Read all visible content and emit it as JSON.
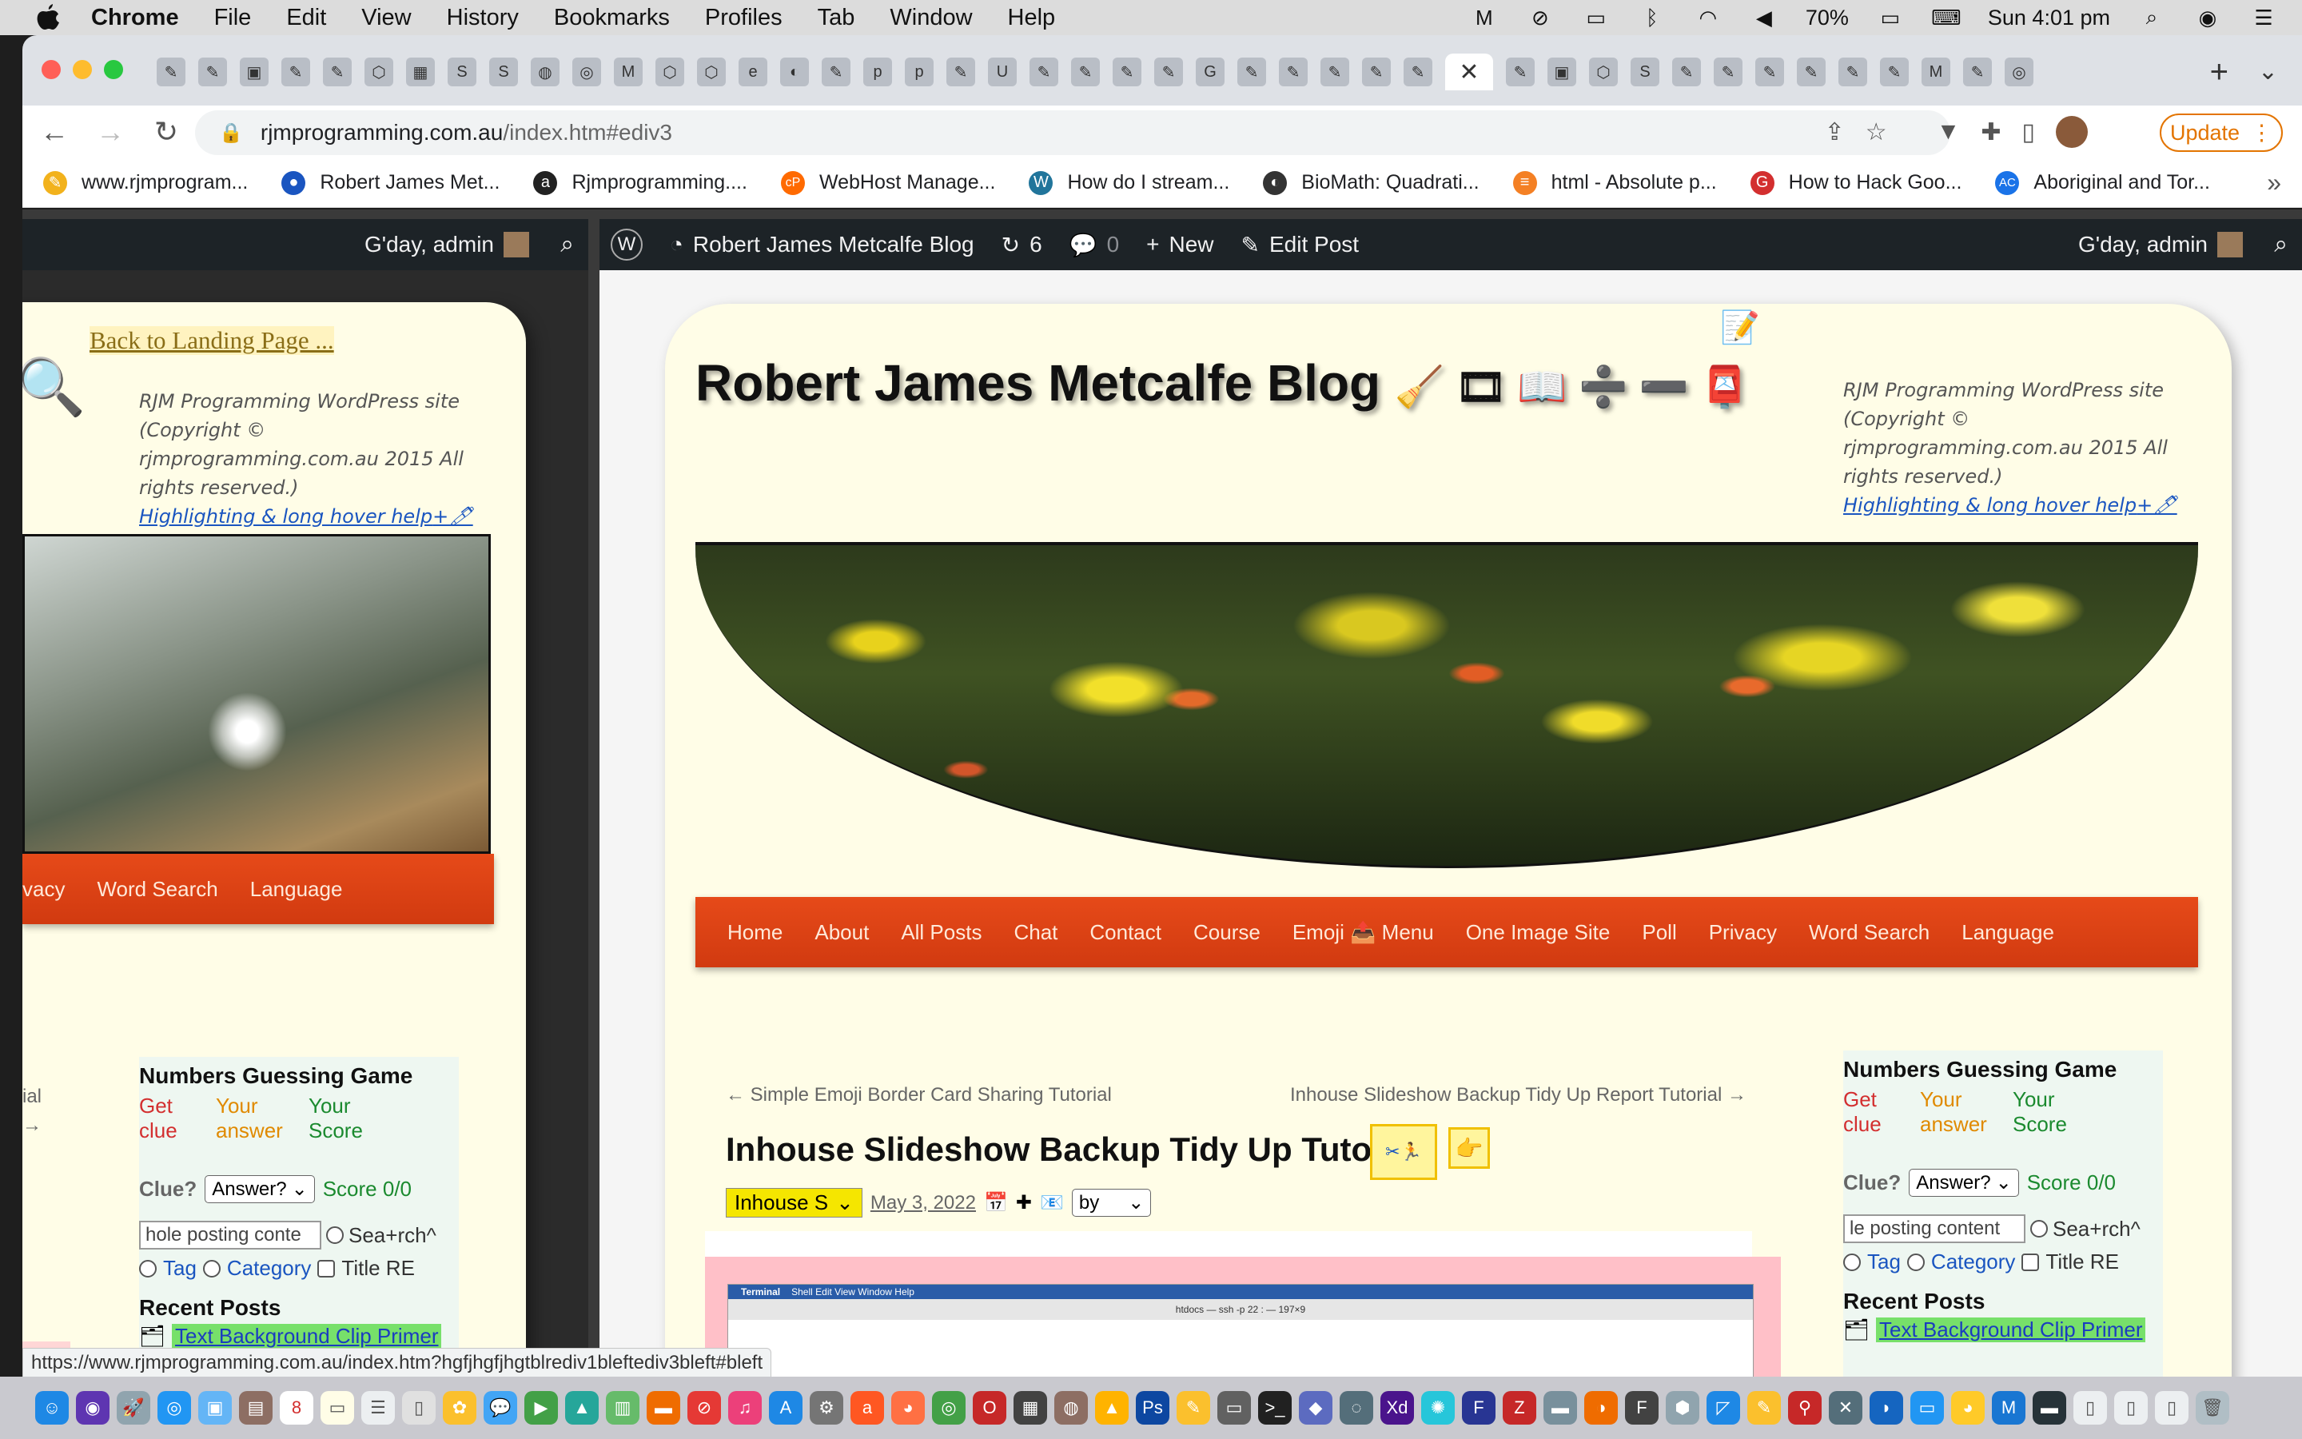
{
  "menubar": {
    "app": "Chrome",
    "items": [
      "File",
      "Edit",
      "View",
      "History",
      "Bookmarks",
      "Profiles",
      "Tab",
      "Window",
      "Help"
    ],
    "battery": "70%",
    "clock": "Sun 4:01 pm"
  },
  "tabs": {
    "close_glyph": "✕",
    "new_tab_glyph": "+",
    "menu_glyph": "⌄"
  },
  "toolbar": {
    "url_host": "rjmprogramming.com.au",
    "url_path": "/index.htm#ediv3",
    "update_label": "Update"
  },
  "bookmarks": [
    {
      "label": "www.rjmprogram...",
      "color": "#f2b21c",
      "glyph": "✎"
    },
    {
      "label": "Robert James Met...",
      "color": "#1a55c0",
      "glyph": "●"
    },
    {
      "label": "Rjmprogramming....",
      "color": "#222222",
      "glyph": "a"
    },
    {
      "label": "WebHost Manage...",
      "color": "#ff6a00",
      "glyph": "cP"
    },
    {
      "label": "How do I stream...",
      "color": "#21759b",
      "glyph": "W"
    },
    {
      "label": "BioMath: Quadrati...",
      "color": "#333333",
      "glyph": "◐"
    },
    {
      "label": "html - Absolute p...",
      "color": "#f48024",
      "glyph": "≡"
    },
    {
      "label": "How to Hack Goo...",
      "color": "#d32f2f",
      "glyph": "G"
    },
    {
      "label": "Aboriginal and Tor...",
      "color": "#1a73e8",
      "glyph": "AC"
    }
  ],
  "adminbar_left": {
    "greeting": "G'day, admin"
  },
  "adminbar_main": {
    "site": "Robert James Metcalfe Blog",
    "updates": "6",
    "comments": "0",
    "new": "New",
    "edit": "Edit Post",
    "greeting": "G'day, admin"
  },
  "left_pane": {
    "back_link": "Back to Landing Page ...",
    "notice": "RJM Programming WordPress site (Copyright © rjmprogramming.com.au 2015 All rights reserved.)",
    "help_link": "Highlighting & long hover help",
    "nav": [
      "vacy",
      "Word Search",
      "Language"
    ],
    "side_fragments": [
      "ial",
      "→"
    ],
    "widget": {
      "title": "Numbers Guessing Game",
      "col1": "Get clue",
      "col2": "Your answer",
      "col3": "Your Score",
      "clue_label": "Clue?",
      "select": "Answer?",
      "score": "Score 0/0",
      "search_value": "hole posting conte",
      "search_radio": "Sea+rch^",
      "tag": "Tag",
      "category": "Category",
      "title_re": "Title RE",
      "recent_heading": "Recent Posts",
      "recent_1": "Text Background Clip Primer"
    }
  },
  "main": {
    "site_title": "Robert James Metcalfe Blog",
    "title_emojis": "🧹 🎞 📖 ➗ ➖ 📮",
    "notice": "RJM Programming WordPress site (Copyright © rjmprogramming.com.au 2015 All rights reserved.)",
    "help_link": "Highlighting & long hover help",
    "nav": [
      "Home",
      "About",
      "All Posts",
      "Chat",
      "Contact",
      "Course",
      "Emoji 📤 Menu",
      "One Image Site",
      "Poll",
      "Privacy",
      "Word Search",
      "Language"
    ],
    "prev_post": "← Simple Emoji Border Card Sharing Tutorial",
    "next_post": "Inhouse Slideshow Backup Tidy Up Report Tutorial →",
    "post_title": "Inhouse Slideshow Backup Tidy Up Tutorial",
    "category_select": "Inhouse S",
    "post_date": "May 3, 2022",
    "by_select": "by",
    "widget": {
      "title": "Numbers Guessing Game",
      "col1": "Get clue",
      "col2": "Your answer",
      "col3": "Your Score",
      "clue_label": "Clue?",
      "select": "Answer?",
      "score": "Score 0/0",
      "search_value": "le posting content",
      "search_radio": "Sea+rch^",
      "tag": "Tag",
      "category": "Category",
      "title_re": "Title RE",
      "recent_heading": "Recent Posts",
      "recent_1": "Text Background Clip Primer"
    },
    "terminal": {
      "app": "Terminal",
      "menu": "Shell  Edit  View  Window  Help",
      "window_title": "htdocs — ssh -p 22 : — 197×9"
    }
  },
  "status_url": "https://www.rjmprogramming.com.au/index.htm?hgfjhgfjhgtblrediv1bleftediv3bleft#bleft",
  "colors": {
    "accent_nav": "#e64a19",
    "card_bg": "#fffde7",
    "admin_bar": "#1d2327"
  }
}
